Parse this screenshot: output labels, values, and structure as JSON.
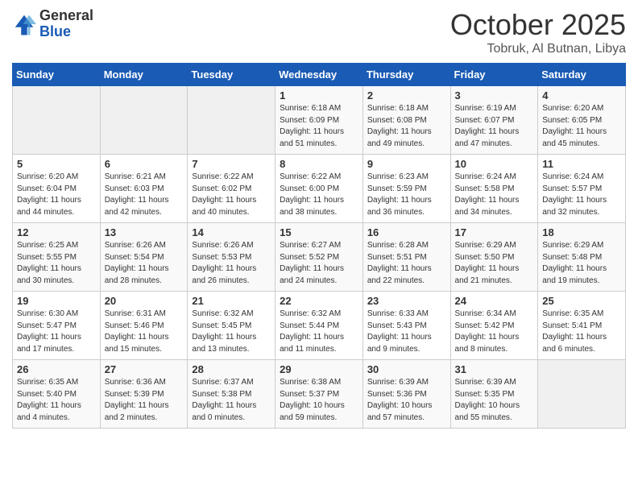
{
  "header": {
    "logo_general": "General",
    "logo_blue": "Blue",
    "month": "October 2025",
    "location": "Tobruk, Al Butnan, Libya"
  },
  "weekdays": [
    "Sunday",
    "Monday",
    "Tuesday",
    "Wednesday",
    "Thursday",
    "Friday",
    "Saturday"
  ],
  "weeks": [
    [
      {
        "day": "",
        "info": ""
      },
      {
        "day": "",
        "info": ""
      },
      {
        "day": "",
        "info": ""
      },
      {
        "day": "1",
        "info": "Sunrise: 6:18 AM\nSunset: 6:09 PM\nDaylight: 11 hours\nand 51 minutes."
      },
      {
        "day": "2",
        "info": "Sunrise: 6:18 AM\nSunset: 6:08 PM\nDaylight: 11 hours\nand 49 minutes."
      },
      {
        "day": "3",
        "info": "Sunrise: 6:19 AM\nSunset: 6:07 PM\nDaylight: 11 hours\nand 47 minutes."
      },
      {
        "day": "4",
        "info": "Sunrise: 6:20 AM\nSunset: 6:05 PM\nDaylight: 11 hours\nand 45 minutes."
      }
    ],
    [
      {
        "day": "5",
        "info": "Sunrise: 6:20 AM\nSunset: 6:04 PM\nDaylight: 11 hours\nand 44 minutes."
      },
      {
        "day": "6",
        "info": "Sunrise: 6:21 AM\nSunset: 6:03 PM\nDaylight: 11 hours\nand 42 minutes."
      },
      {
        "day": "7",
        "info": "Sunrise: 6:22 AM\nSunset: 6:02 PM\nDaylight: 11 hours\nand 40 minutes."
      },
      {
        "day": "8",
        "info": "Sunrise: 6:22 AM\nSunset: 6:00 PM\nDaylight: 11 hours\nand 38 minutes."
      },
      {
        "day": "9",
        "info": "Sunrise: 6:23 AM\nSunset: 5:59 PM\nDaylight: 11 hours\nand 36 minutes."
      },
      {
        "day": "10",
        "info": "Sunrise: 6:24 AM\nSunset: 5:58 PM\nDaylight: 11 hours\nand 34 minutes."
      },
      {
        "day": "11",
        "info": "Sunrise: 6:24 AM\nSunset: 5:57 PM\nDaylight: 11 hours\nand 32 minutes."
      }
    ],
    [
      {
        "day": "12",
        "info": "Sunrise: 6:25 AM\nSunset: 5:55 PM\nDaylight: 11 hours\nand 30 minutes."
      },
      {
        "day": "13",
        "info": "Sunrise: 6:26 AM\nSunset: 5:54 PM\nDaylight: 11 hours\nand 28 minutes."
      },
      {
        "day": "14",
        "info": "Sunrise: 6:26 AM\nSunset: 5:53 PM\nDaylight: 11 hours\nand 26 minutes."
      },
      {
        "day": "15",
        "info": "Sunrise: 6:27 AM\nSunset: 5:52 PM\nDaylight: 11 hours\nand 24 minutes."
      },
      {
        "day": "16",
        "info": "Sunrise: 6:28 AM\nSunset: 5:51 PM\nDaylight: 11 hours\nand 22 minutes."
      },
      {
        "day": "17",
        "info": "Sunrise: 6:29 AM\nSunset: 5:50 PM\nDaylight: 11 hours\nand 21 minutes."
      },
      {
        "day": "18",
        "info": "Sunrise: 6:29 AM\nSunset: 5:48 PM\nDaylight: 11 hours\nand 19 minutes."
      }
    ],
    [
      {
        "day": "19",
        "info": "Sunrise: 6:30 AM\nSunset: 5:47 PM\nDaylight: 11 hours\nand 17 minutes."
      },
      {
        "day": "20",
        "info": "Sunrise: 6:31 AM\nSunset: 5:46 PM\nDaylight: 11 hours\nand 15 minutes."
      },
      {
        "day": "21",
        "info": "Sunrise: 6:32 AM\nSunset: 5:45 PM\nDaylight: 11 hours\nand 13 minutes."
      },
      {
        "day": "22",
        "info": "Sunrise: 6:32 AM\nSunset: 5:44 PM\nDaylight: 11 hours\nand 11 minutes."
      },
      {
        "day": "23",
        "info": "Sunrise: 6:33 AM\nSunset: 5:43 PM\nDaylight: 11 hours\nand 9 minutes."
      },
      {
        "day": "24",
        "info": "Sunrise: 6:34 AM\nSunset: 5:42 PM\nDaylight: 11 hours\nand 8 minutes."
      },
      {
        "day": "25",
        "info": "Sunrise: 6:35 AM\nSunset: 5:41 PM\nDaylight: 11 hours\nand 6 minutes."
      }
    ],
    [
      {
        "day": "26",
        "info": "Sunrise: 6:35 AM\nSunset: 5:40 PM\nDaylight: 11 hours\nand 4 minutes."
      },
      {
        "day": "27",
        "info": "Sunrise: 6:36 AM\nSunset: 5:39 PM\nDaylight: 11 hours\nand 2 minutes."
      },
      {
        "day": "28",
        "info": "Sunrise: 6:37 AM\nSunset: 5:38 PM\nDaylight: 11 hours\nand 0 minutes."
      },
      {
        "day": "29",
        "info": "Sunrise: 6:38 AM\nSunset: 5:37 PM\nDaylight: 10 hours\nand 59 minutes."
      },
      {
        "day": "30",
        "info": "Sunrise: 6:39 AM\nSunset: 5:36 PM\nDaylight: 10 hours\nand 57 minutes."
      },
      {
        "day": "31",
        "info": "Sunrise: 6:39 AM\nSunset: 5:35 PM\nDaylight: 10 hours\nand 55 minutes."
      },
      {
        "day": "",
        "info": ""
      }
    ]
  ]
}
